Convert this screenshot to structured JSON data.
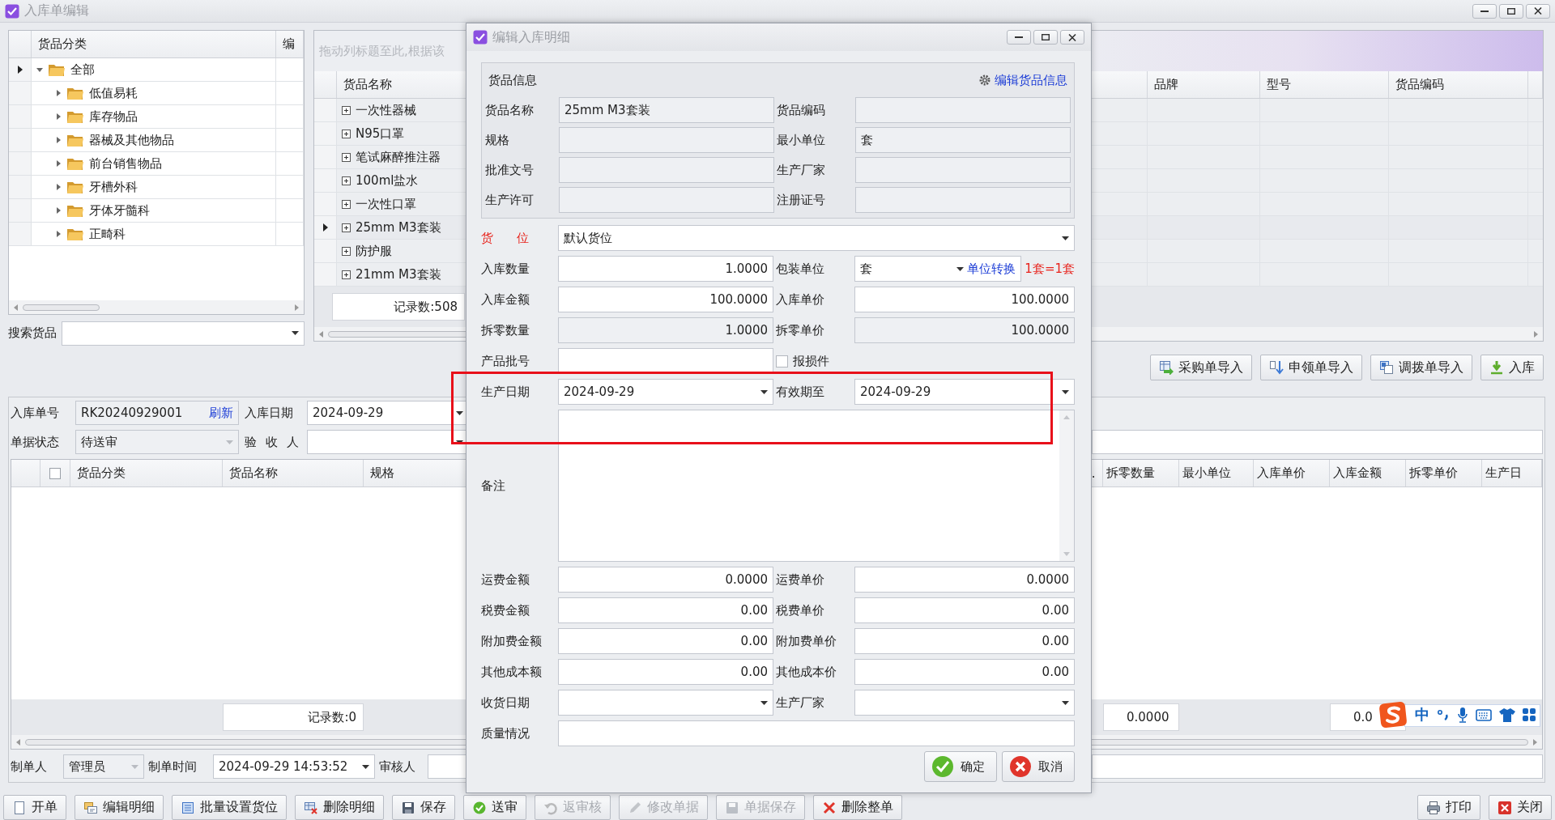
{
  "window": {
    "title": "入库单编辑"
  },
  "category_tree": {
    "columns": [
      "货品分类",
      "编"
    ],
    "items": [
      {
        "label": "全部",
        "expanded": true,
        "selected": true,
        "children": [
          {
            "label": "低值易耗",
            "expanded": false,
            "selected": false
          },
          {
            "label": "库存物品",
            "expanded": false,
            "selected": false
          },
          {
            "label": "器械及其他物品",
            "expanded": false,
            "selected": false
          },
          {
            "label": "前台销售物品",
            "expanded": false,
            "selected": false
          },
          {
            "label": "牙槽外科",
            "expanded": false,
            "selected": false
          },
          {
            "label": "牙体牙髓科",
            "expanded": false,
            "selected": false
          },
          {
            "label": "正畸科",
            "expanded": false,
            "selected": false
          }
        ]
      }
    ]
  },
  "goods_search": {
    "label": "搜索货品"
  },
  "goods_grid": {
    "group_hint": "拖动列标题至此,根据该",
    "columns_left": [
      "货品名称"
    ],
    "columns_right": [
      "品牌",
      "型号",
      "货品编码"
    ],
    "rows": [
      {
        "name": "一次性器械",
        "selected": false
      },
      {
        "name": "N95口罩",
        "selected": false
      },
      {
        "name": "笔试麻醉推注器",
        "selected": false
      },
      {
        "name": "100ml盐水",
        "selected": false
      },
      {
        "name": "一次性口罩",
        "selected": false
      },
      {
        "name": "25mm M3套装",
        "selected": true
      },
      {
        "name": "防护服",
        "selected": false
      },
      {
        "name": "21mm M3套装",
        "selected": false
      }
    ],
    "record_count": "记录数:508"
  },
  "import_buttons": [
    "采购单导入",
    "申领单导入",
    "调拨单导入",
    "入库"
  ],
  "order_form": {
    "rows": [
      [
        {
          "label": "入库单号",
          "value": "RK20240929001",
          "kind": "text",
          "readonly": true,
          "link": "刷新"
        },
        {
          "label": "入库日期",
          "value": "2024-09-29",
          "kind": "combo",
          "readonly": false
        }
      ],
      [
        {
          "label": "单据状态",
          "value": "待送审",
          "kind": "combo",
          "readonly": true
        },
        {
          "label": "验 收 人",
          "kind": "combo",
          "readonly": false
        },
        {
          "kind": "text",
          "readonly": false
        }
      ]
    ]
  },
  "detail_grid": {
    "columns_left": [
      {
        "kind": "checkbox",
        "checked": false
      },
      {
        "kind": "text",
        "label": "货品分类"
      },
      {
        "kind": "text",
        "label": "货品名称"
      },
      {
        "kind": "text",
        "label": "规格"
      }
    ],
    "columns_right": [
      {
        "label": ".."
      },
      {
        "label": "拆零数量",
        "total": "0.0000"
      },
      {
        "label": "最小单位"
      },
      {
        "label": "入库单价"
      },
      {
        "label": "入库金额",
        "total": "0.0"
      },
      {
        "label": "拆零单价"
      },
      {
        "label": "生产日"
      }
    ],
    "record_count": "记录数:0"
  },
  "footer_form": [
    {
      "label": "制单人",
      "value": "管理员",
      "kind": "combo",
      "readonly": true
    },
    {
      "label": "制单时间",
      "value": "2024-09-29 14:53:52",
      "kind": "combo",
      "readonly": false
    },
    {
      "label": "审核人",
      "kind": "text",
      "readonly": false
    },
    {
      "kind": "text",
      "readonly": false
    }
  ],
  "toolbar_left": [
    {
      "label": "开单",
      "disabled": false
    },
    {
      "label": "编辑明细",
      "disabled": false
    },
    {
      "label": "批量设置货位",
      "disabled": false
    },
    {
      "label": "删除明细",
      "disabled": false
    },
    {
      "label": "保存",
      "disabled": false
    },
    {
      "label": "送审",
      "disabled": false
    },
    {
      "label": "返审核",
      "disabled": true
    },
    {
      "label": "修改单据",
      "disabled": true
    },
    {
      "label": "单据保存",
      "disabled": true
    },
    {
      "label": "删除整单",
      "disabled": false
    }
  ],
  "toolbar_right": [
    {
      "label": "打印",
      "disabled": false
    },
    {
      "label": "关闭",
      "disabled": false
    }
  ],
  "dialog": {
    "title": "编辑入库明细",
    "goods_info": {
      "title": "货品信息",
      "link": "编辑货品信息",
      "rows": [
        [
          {
            "label": "货品名称",
            "value": "25mm M3套装",
            "kind": "text",
            "readonly": true
          },
          {
            "label": "货品编码",
            "kind": "text",
            "readonly": true
          }
        ],
        [
          {
            "label": "规格",
            "kind": "text",
            "readonly": true
          },
          {
            "label": "最小单位",
            "value": "套",
            "kind": "text",
            "readonly": true
          }
        ],
        [
          {
            "label": "批准文号",
            "kind": "text",
            "readonly": true
          },
          {
            "label": "生产厂家",
            "kind": "text",
            "readonly": true
          }
        ],
        [
          {
            "label": "生产许可",
            "kind": "text",
            "readonly": true
          },
          {
            "label": "注册证号",
            "kind": "text",
            "readonly": true
          }
        ]
      ]
    },
    "rows": [
      [
        {
          "label": "货 位",
          "value": "默认货位",
          "kind": "combo",
          "readonly": false,
          "required": true
        }
      ],
      [
        {
          "label": "入库数量",
          "value": "1.0000",
          "kind": "number",
          "readonly": false
        },
        {
          "label": "包装单位",
          "value": "套",
          "kind": "combo",
          "readonly": false,
          "link": "单位转换",
          "note": "1套=1套"
        }
      ],
      [
        {
          "label": "入库金额",
          "value": "100.0000",
          "kind": "number",
          "readonly": false
        },
        {
          "label": "入库单价",
          "value": "100.0000",
          "kind": "number",
          "readonly": false
        }
      ],
      [
        {
          "label": "拆零数量",
          "value": "1.0000",
          "kind": "number",
          "readonly": true
        },
        {
          "label": "拆零单价",
          "value": "100.0000",
          "kind": "number",
          "readonly": true
        }
      ],
      [
        {
          "label": "产品批号",
          "kind": "text",
          "readonly": false
        },
        {
          "label": "报损件",
          "kind": "checkbox",
          "checked": false
        }
      ],
      [
        {
          "label": "生产日期",
          "value": "2024-09-29",
          "kind": "combo",
          "readonly": false
        },
        {
          "label": "有效期至",
          "value": "2024-09-29",
          "kind": "combo",
          "readonly": false
        }
      ],
      [
        {
          "label": "备注",
          "kind": "textarea",
          "readonly": false
        }
      ],
      [
        {
          "label": "运费金额",
          "value": "0.0000",
          "kind": "number",
          "readonly": false
        },
        {
          "label": "运费单价",
          "value": "0.0000",
          "kind": "number",
          "readonly": false
        }
      ],
      [
        {
          "label": "税费金额",
          "value": "0.00",
          "kind": "number",
          "readonly": false
        },
        {
          "label": "税费单价",
          "value": "0.00",
          "kind": "number",
          "readonly": false
        }
      ],
      [
        {
          "label": "附加费金额",
          "value": "0.00",
          "kind": "number",
          "readonly": false
        },
        {
          "label": "附加费单价",
          "value": "0.00",
          "kind": "number",
          "readonly": false
        }
      ],
      [
        {
          "label": "其他成本额",
          "value": "0.00",
          "kind": "number",
          "readonly": false
        },
        {
          "label": "其他成本价",
          "value": "0.00",
          "kind": "number",
          "readonly": false
        }
      ],
      [
        {
          "label": "收货日期",
          "kind": "combo",
          "readonly": false
        },
        {
          "label": "生产厂家",
          "kind": "combo",
          "readonly": false
        }
      ],
      [
        {
          "label": "质量情况",
          "kind": "text",
          "readonly": false
        }
      ]
    ],
    "buttons": [
      {
        "label": "确定",
        "kind": "ok"
      },
      {
        "label": "取消",
        "kind": "cancel"
      }
    ]
  },
  "highlight": {
    "kind": "rectangle"
  },
  "input_method": {
    "mode": "中"
  }
}
